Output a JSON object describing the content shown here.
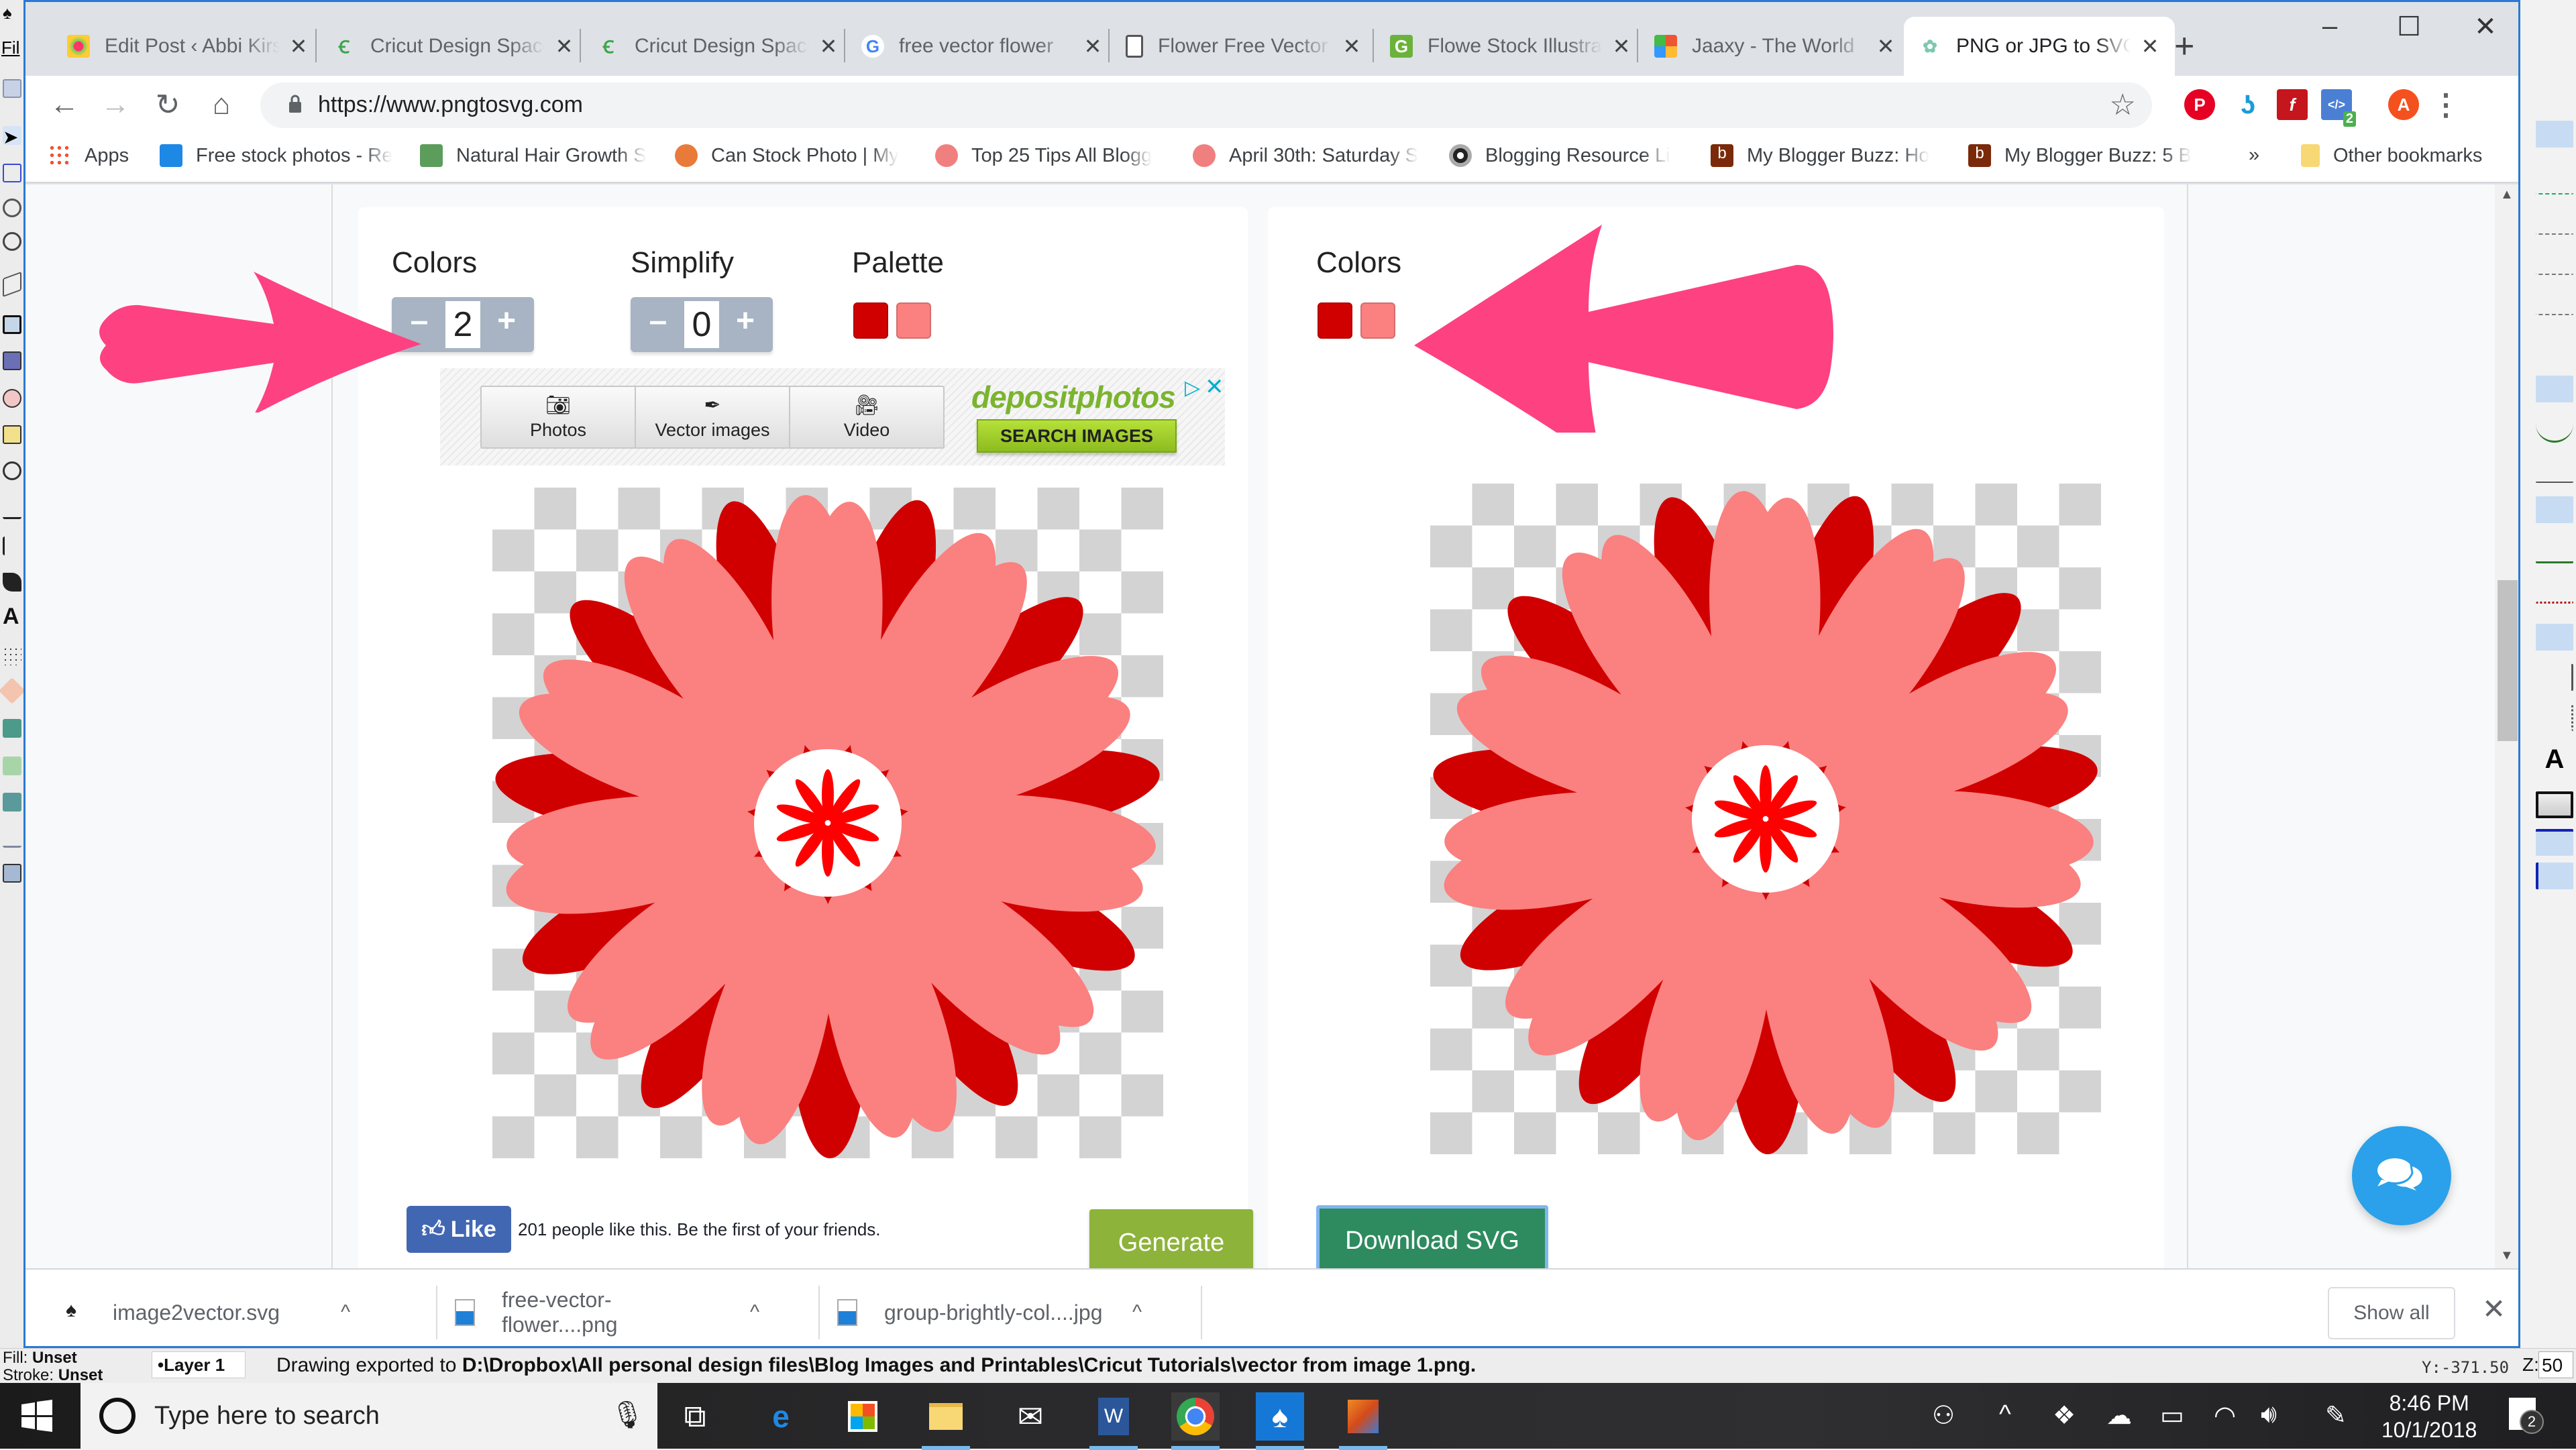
{
  "inkscape": {
    "menu_file": "Fil",
    "status": {
      "fill_label": "Fill:",
      "fill_value": "Unset",
      "stroke_label": "Stroke:",
      "stroke_value": "Unset",
      "layer": "•Layer 1",
      "message_prefix": "Drawing exported to ",
      "message_path": "D:\\Dropbox\\All personal design files\\Blog Images and Printables\\Cricut Tutorials\\vector from image 1.png",
      "message_suffix": ".",
      "y_coord": "Y:-371.50",
      "zoom_label": "Z:",
      "zoom_value": "50"
    }
  },
  "browser": {
    "tabs": [
      {
        "title": "Edit Post ‹ Abbi Kirsten",
        "icon": "flower-favicon",
        "active": false
      },
      {
        "title": "Cricut Design Space",
        "icon": "cricut-favicon",
        "active": false
      },
      {
        "title": "Cricut Design Space",
        "icon": "cricut-favicon",
        "active": false
      },
      {
        "title": "free vector flower",
        "icon": "google-favicon",
        "active": false
      },
      {
        "title": "Flower Free Vector",
        "icon": "page-favicon",
        "active": false
      },
      {
        "title": "Flowe Stock Illustrations",
        "icon": "stock-favicon",
        "active": false
      },
      {
        "title": "Jaaxy - The World",
        "icon": "jaaxy-favicon",
        "active": false
      },
      {
        "title": "PNG or JPG to SVG",
        "icon": "pngtosvg-favicon",
        "active": true
      }
    ],
    "new_tab": "+",
    "window_controls": {
      "minimize": "–",
      "maximize": "☐",
      "close": "✕"
    },
    "url": "https://www.pngtosvg.com",
    "extensions": [
      {
        "name": "pinterest",
        "label": "P",
        "color": "#e60023"
      },
      {
        "name": "stream",
        "label": "",
        "color": "#1a9cd8"
      },
      {
        "name": "flash",
        "label": "f",
        "color": "#c4161c"
      },
      {
        "name": "devtools",
        "label": "</>",
        "color": "#4a7fd4",
        "badge": "2"
      },
      {
        "name": "profile",
        "label": "A",
        "color": "#f4511e"
      }
    ],
    "bookmarks": [
      {
        "label": "Apps",
        "icon": "apps-grid"
      },
      {
        "label": "Free stock photos - Re",
        "icon": "stock-photo",
        "color": "#1e88e5"
      },
      {
        "label": "Natural Hair Growth S",
        "icon": "hair",
        "color": "#5c9d5c"
      },
      {
        "label": "Can Stock Photo | My",
        "icon": "canstock",
        "color": "#e87a3a"
      },
      {
        "label": "Top 25 Tips All Blogg",
        "icon": "tips",
        "color": "#f08080"
      },
      {
        "label": "April 30th: Saturday S",
        "icon": "april",
        "color": "#f08080"
      },
      {
        "label": "Blogging Resource Li",
        "icon": "blogging",
        "color": "#222"
      },
      {
        "label": "My Blogger Buzz: Ho",
        "icon": "buzz",
        "color": "#7a2a0a"
      },
      {
        "label": "My Blogger Buzz: 5 B",
        "icon": "buzz",
        "color": "#7a2a0a"
      }
    ],
    "bookmarks_overflow": "»",
    "other_bookmarks": "Other bookmarks"
  },
  "page": {
    "left_panel": {
      "colors_label": "Colors",
      "colors_value": "2",
      "simplify_label": "Simplify",
      "simplify_value": "0",
      "palette_label": "Palette",
      "palette": [
        "#d10000",
        "#fb8080"
      ],
      "minus": "–",
      "plus": "+",
      "ad": {
        "buttons": [
          {
            "label": "Photos",
            "icon": "camera-icon"
          },
          {
            "label": "Vector images",
            "icon": "pen-nib-icon"
          },
          {
            "label": "Video",
            "icon": "video-camera-icon"
          }
        ],
        "brand": "depositphotos",
        "cta": "SEARCH IMAGES",
        "info": "▷",
        "close": "✕"
      },
      "like_button": "Like",
      "like_text": "201 people like this. Be the first of your friends.",
      "generate_label": "Generate"
    },
    "right_panel": {
      "colors_label": "Colors",
      "palette": [
        "#d10000",
        "#fb8080"
      ],
      "download_label": "Download SVG"
    },
    "flower_colors": {
      "dark": "#d10000",
      "light": "#fb8080",
      "center": "#ff0000"
    },
    "annotation_color": "#fe4181"
  },
  "downloads": {
    "items": [
      {
        "name": "image2vector.svg",
        "icon": "inkscape-file-icon"
      },
      {
        "name": "free-vector-flower....png",
        "icon": "image-file-icon"
      },
      {
        "name": "group-brightly-col....jpg",
        "icon": "image-file-icon"
      }
    ],
    "caret": "^",
    "show_all": "Show all",
    "close": "✕"
  },
  "taskbar": {
    "search_placeholder": "Type here to search",
    "time": "8:46 PM",
    "date": "10/1/2018",
    "notification_count": "2",
    "apps": [
      "task-view",
      "edge",
      "store",
      "file-explorer",
      "mail",
      "word",
      "chrome",
      "inkscape",
      "paint"
    ]
  }
}
